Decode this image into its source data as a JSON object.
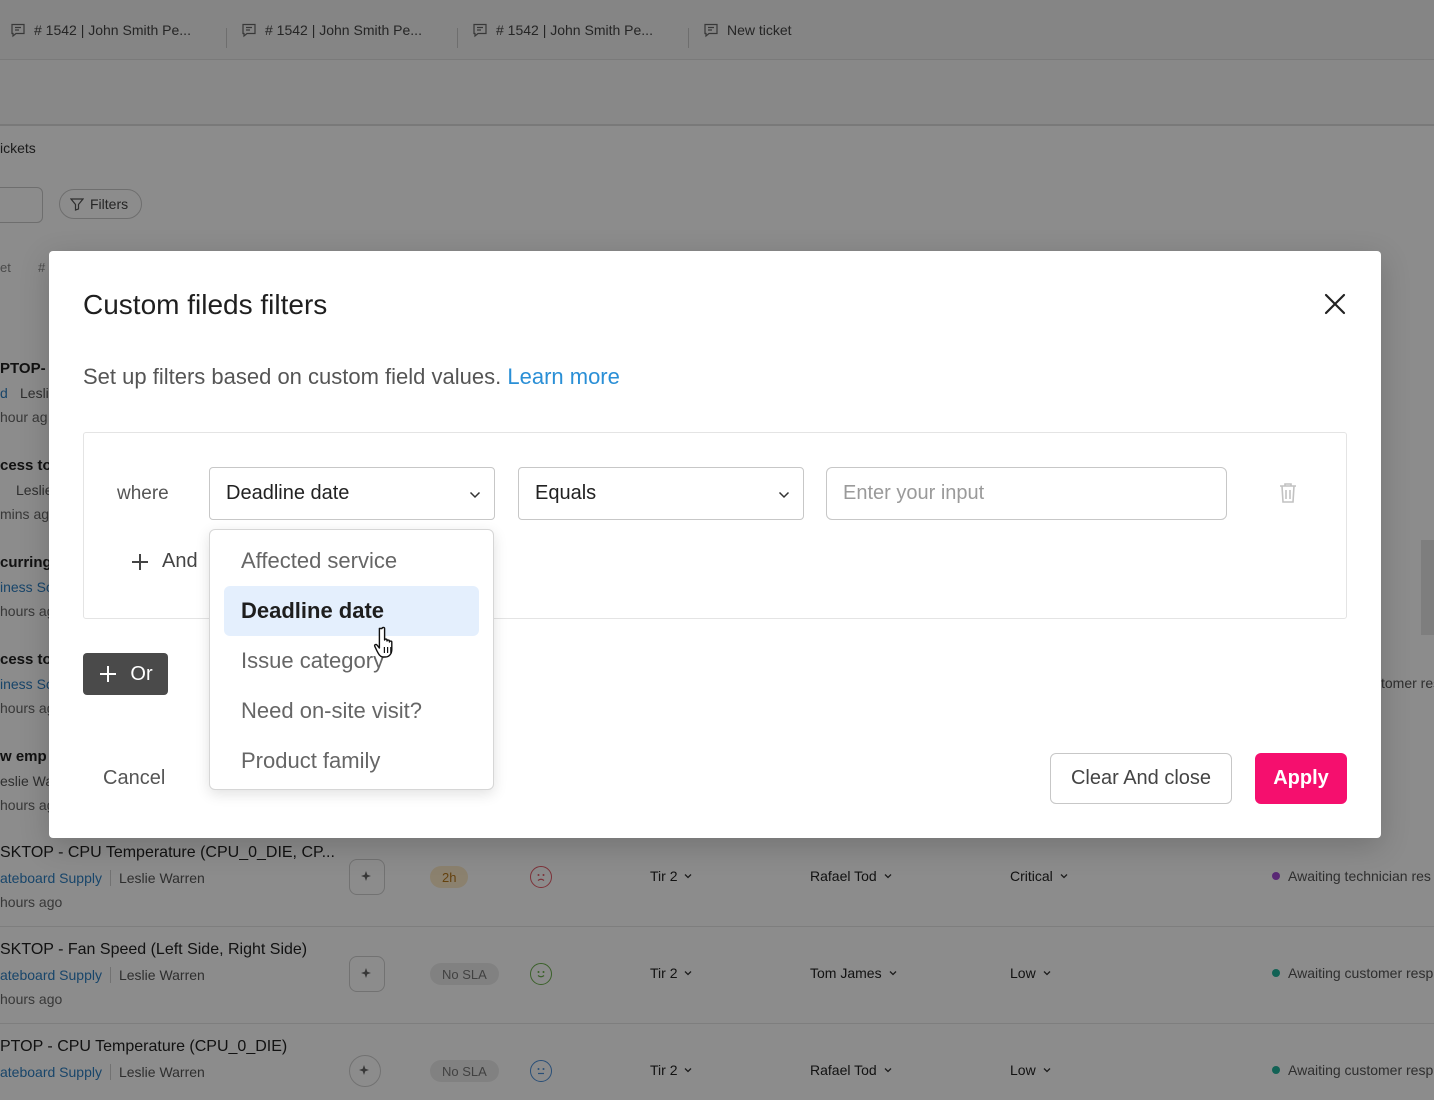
{
  "tabs": [
    {
      "label": "# 1542 | John Smith Pe..."
    },
    {
      "label": "# 1542 | John Smith Pe..."
    },
    {
      "label": "# 1542 | John Smith Pe..."
    },
    {
      "label": "New ticket"
    }
  ],
  "page": {
    "section_title": "ickets",
    "filters_label": "Filters",
    "header_stubs": [
      "et",
      "#"
    ]
  },
  "left_stubs": [
    {
      "title": "PTOP-",
      "meta": "d",
      "person": "Lesli",
      "time": "hour ag"
    },
    {
      "title": "cess to",
      "person": "Leslie",
      "time": "mins ag"
    },
    {
      "title": "curring",
      "meta": "iness Sc",
      "time": "hours ag"
    },
    {
      "title": "cess to",
      "meta": "iness Sc",
      "time": "hours ag"
    },
    {
      "title": "w emp",
      "person": "eslie Wa",
      "time": "hours ag"
    }
  ],
  "right_stub": "tomer res",
  "rows": [
    {
      "title": "SKTOP - CPU Temperature (CPU_0_DIE, CP...",
      "org": "ateboard Supply",
      "person": "Leslie Warren",
      "time": "hours ago",
      "sla": "2h",
      "sla_type": "warn",
      "mood": "sad",
      "tier": "Tir 2",
      "agent": "Rafael Tod",
      "priority": "Critical",
      "status": "Awaiting technician res",
      "status_color": "#a44bd6"
    },
    {
      "title": "SKTOP - Fan Speed (Left Side, Right Side)",
      "org": "ateboard Supply",
      "person": "Leslie Warren",
      "time": "hours ago",
      "sla": "No SLA",
      "sla_type": "none",
      "mood": "happy",
      "tier": "Tir 2",
      "agent": "Tom James",
      "priority": "Low",
      "status": "Awaiting customer resp",
      "status_color": "#22b39c"
    },
    {
      "title": "PTOP - CPU Temperature (CPU_0_DIE)",
      "org": "ateboard Supply",
      "person": "Leslie Warren",
      "time": "",
      "sla": "No SLA",
      "sla_type": "none",
      "mood": "neutral",
      "tier": "Tir 2",
      "agent": "Rafael Tod",
      "priority": "Low",
      "status": "Awaiting customer resp",
      "status_color": "#22b39c"
    }
  ],
  "modal": {
    "title": "Custom fileds filters",
    "description": "Set up filters based on custom field values.",
    "learn_more": "Learn more",
    "where_label": "where",
    "field_select": "Deadline date",
    "operator_select": "Equals",
    "input_placeholder": "Enter your input",
    "and_label": "And",
    "or_label": "Or",
    "cancel_label": "Cancel",
    "clear_label": "Clear And close",
    "apply_label": "Apply"
  },
  "dropdown": {
    "options": [
      {
        "label": "Affected service",
        "selected": false
      },
      {
        "label": "Deadline date",
        "selected": true
      },
      {
        "label": "Issue category",
        "selected": false
      },
      {
        "label": "Need on-site visit?",
        "selected": false
      },
      {
        "label": "Product family",
        "selected": false
      }
    ]
  },
  "colors": {
    "accent": "#f50f6e",
    "link": "#2a8fd6",
    "selected_bg": "#e4effd",
    "or_button": "#4a4a4a"
  }
}
